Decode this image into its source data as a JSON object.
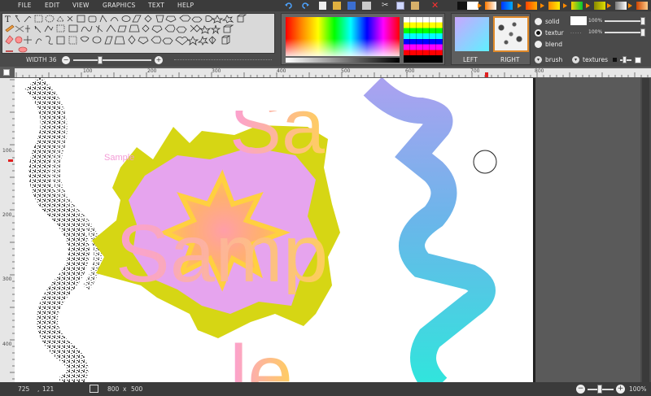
{
  "menu": [
    "FILE",
    "EDIT",
    "VIEW",
    "GRAPHICS",
    "TEXT",
    "HELP"
  ],
  "top_swatches": [
    "#111111",
    "#ffffff",
    "#ff8a00",
    "#0044ff",
    "#ff6a00",
    "#ff2200",
    "#ffee00",
    "#00cc22",
    "#aaaa00",
    "#b0b0b0",
    "#ffffff",
    "#ff6600"
  ],
  "width_control": {
    "label": "WIDTH 36",
    "value": 36
  },
  "fill_modes": [
    {
      "label": "solid",
      "selected": false
    },
    {
      "label": "textur",
      "selected": true
    },
    {
      "label": "blend",
      "selected": false
    }
  ],
  "opacity_1": "100%",
  "opacity_2": "100%",
  "left_label": "LEFT",
  "right_label": "RIGHT",
  "brush_label": "brush",
  "textures_label": "textures",
  "ruler_h_labels": [
    "100",
    "200",
    "300",
    "400",
    "500",
    "600",
    "700",
    "800"
  ],
  "ruler_v_labels": [
    "100",
    "200",
    "300",
    "400"
  ],
  "canvas_text_small": "Sample",
  "canvas_text_big_top": "Sa",
  "canvas_text_big_mid": "Samp",
  "canvas_text_big_bottom": "le",
  "status": {
    "x": "725",
    "y": "121",
    "size_w": "800",
    "size_x": "x",
    "size_h": "500",
    "zoom": "100%"
  },
  "colors": {
    "bg": "#5a5a5a",
    "menubar": "#3b3b3b",
    "accent_orange": "#e08a2a",
    "blob_yellow": "#d6d614",
    "blob_pink": "#e8a2ee",
    "text_pink": "#f9a0d0",
    "text_orange": "#ffcc55"
  }
}
